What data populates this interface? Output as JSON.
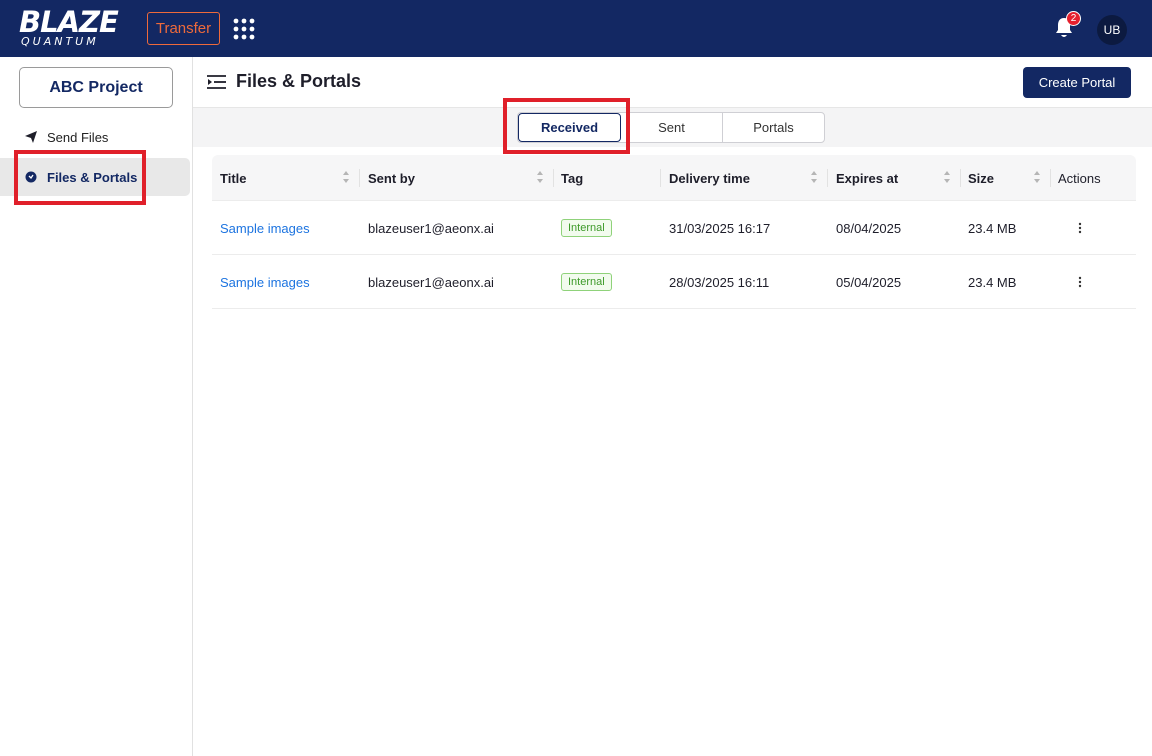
{
  "app": {
    "logo_main": "BLAZE",
    "logo_sub": "QUANTUM",
    "module_button": "Transfer",
    "notifications_count": "2",
    "user_initials": "UB"
  },
  "sidebar": {
    "project": "ABC Project",
    "items": [
      {
        "label": "Send Files",
        "icon": "send-icon"
      },
      {
        "label": "Files & Portals",
        "icon": "chat-icon",
        "active": true
      }
    ]
  },
  "header": {
    "title": "Files & Portals",
    "create_button": "Create Portal"
  },
  "tabs": [
    {
      "label": "Received",
      "active": true
    },
    {
      "label": "Sent"
    },
    {
      "label": "Portals"
    }
  ],
  "table": {
    "columns": [
      "Title",
      "Sent by",
      "Tag",
      "Delivery time",
      "Expires at",
      "Size",
      "Actions"
    ],
    "rows": [
      {
        "title": "Sample images",
        "sent_by": "blazeuser1@aeonx.ai",
        "tag": "Internal",
        "delivery": "31/03/2025 16:17",
        "expires": "08/04/2025",
        "size": "23.4 MB"
      },
      {
        "title": "Sample images",
        "sent_by": "blazeuser1@aeonx.ai",
        "tag": "Internal",
        "delivery": "28/03/2025 16:11",
        "expires": "05/04/2025",
        "size": "23.4 MB"
      }
    ]
  },
  "colors": {
    "brand_navy": "#132863",
    "accent_orange": "#ee6a3b",
    "link_blue": "#1d74e0",
    "tag_green": "#3e9a2a",
    "highlight_red": "#e0202a"
  }
}
